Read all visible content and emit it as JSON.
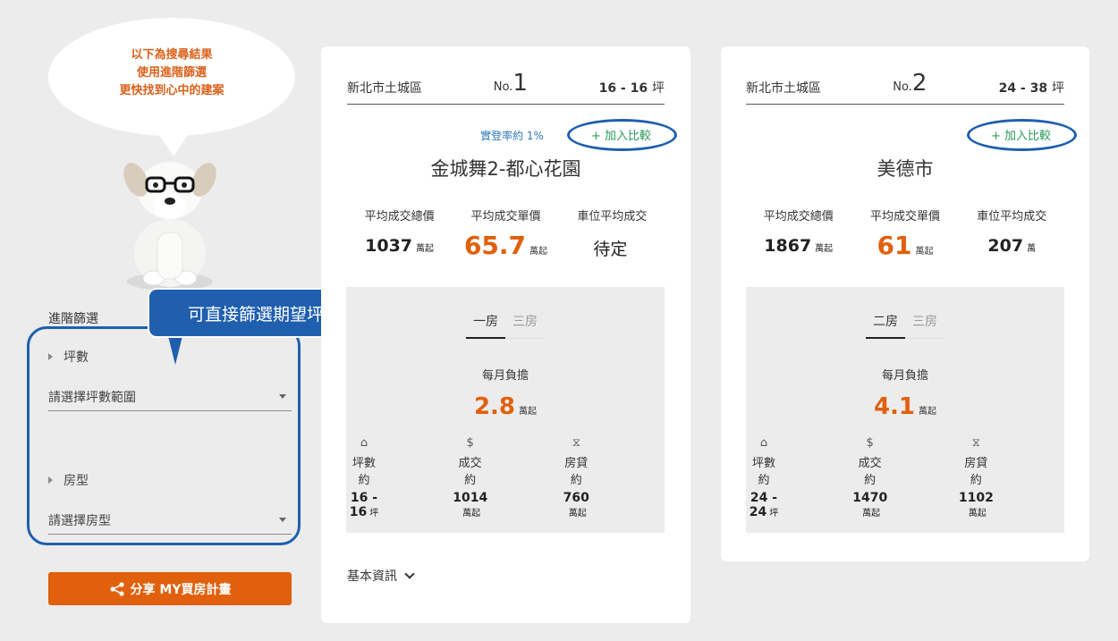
{
  "bubble": {
    "lines": [
      "以下為搜尋結果",
      "使用進階篩選",
      "更快找到心中的建案"
    ]
  },
  "sidebar": {
    "title": "進階篩選",
    "size_filter": {
      "label": "坪數",
      "placeholder": "請選擇坪數範圍"
    },
    "room_filter": {
      "label": "房型",
      "placeholder": "請選擇房型"
    },
    "share_label": "分享 MY買房計畫"
  },
  "tooltip": "可直接篩選期望坪數、房型",
  "labels": {
    "total_price": "平均成交總價",
    "unit_price": "平均成交單價",
    "parking": "車位平均成交",
    "monthly": "每月負擔",
    "area": "坪數約",
    "deal": "成交約",
    "loan": "房貸約",
    "compare": "+ 加入比較",
    "basic_info": "基本資訊",
    "rank_prefix": "No."
  },
  "cards": [
    {
      "district": "新北市土城區",
      "rank": "1",
      "size_range": "16 - 16",
      "size_unit": "坪",
      "rate": "實登率約 1%",
      "name": "金城舞2-都心花園",
      "total_price": "1037",
      "total_unit": "萬起",
      "unit_price": "65.7",
      "unit_unit": "萬起",
      "parking": "待定",
      "parking_unit": "",
      "tabs": [
        "一房",
        "三房"
      ],
      "monthly": "2.8",
      "monthly_unit": "萬起",
      "area": "16 - 16",
      "area_unit": "坪",
      "deal": "1014",
      "deal_unit": "萬起",
      "loan": "760",
      "loan_unit": "萬起"
    },
    {
      "district": "新北市土城區",
      "rank": "2",
      "size_range": "24 - 38",
      "size_unit": "坪",
      "rate": "",
      "name": "美德市",
      "total_price": "1867",
      "total_unit": "萬起",
      "unit_price": "61",
      "unit_unit": "萬起",
      "parking": "207",
      "parking_unit": "萬",
      "tabs": [
        "二房",
        "三房"
      ],
      "monthly": "4.1",
      "monthly_unit": "萬起",
      "area": "24 - 24",
      "area_unit": "坪",
      "deal": "1470",
      "deal_unit": "萬起",
      "loan": "1102",
      "loan_unit": "萬起"
    }
  ]
}
